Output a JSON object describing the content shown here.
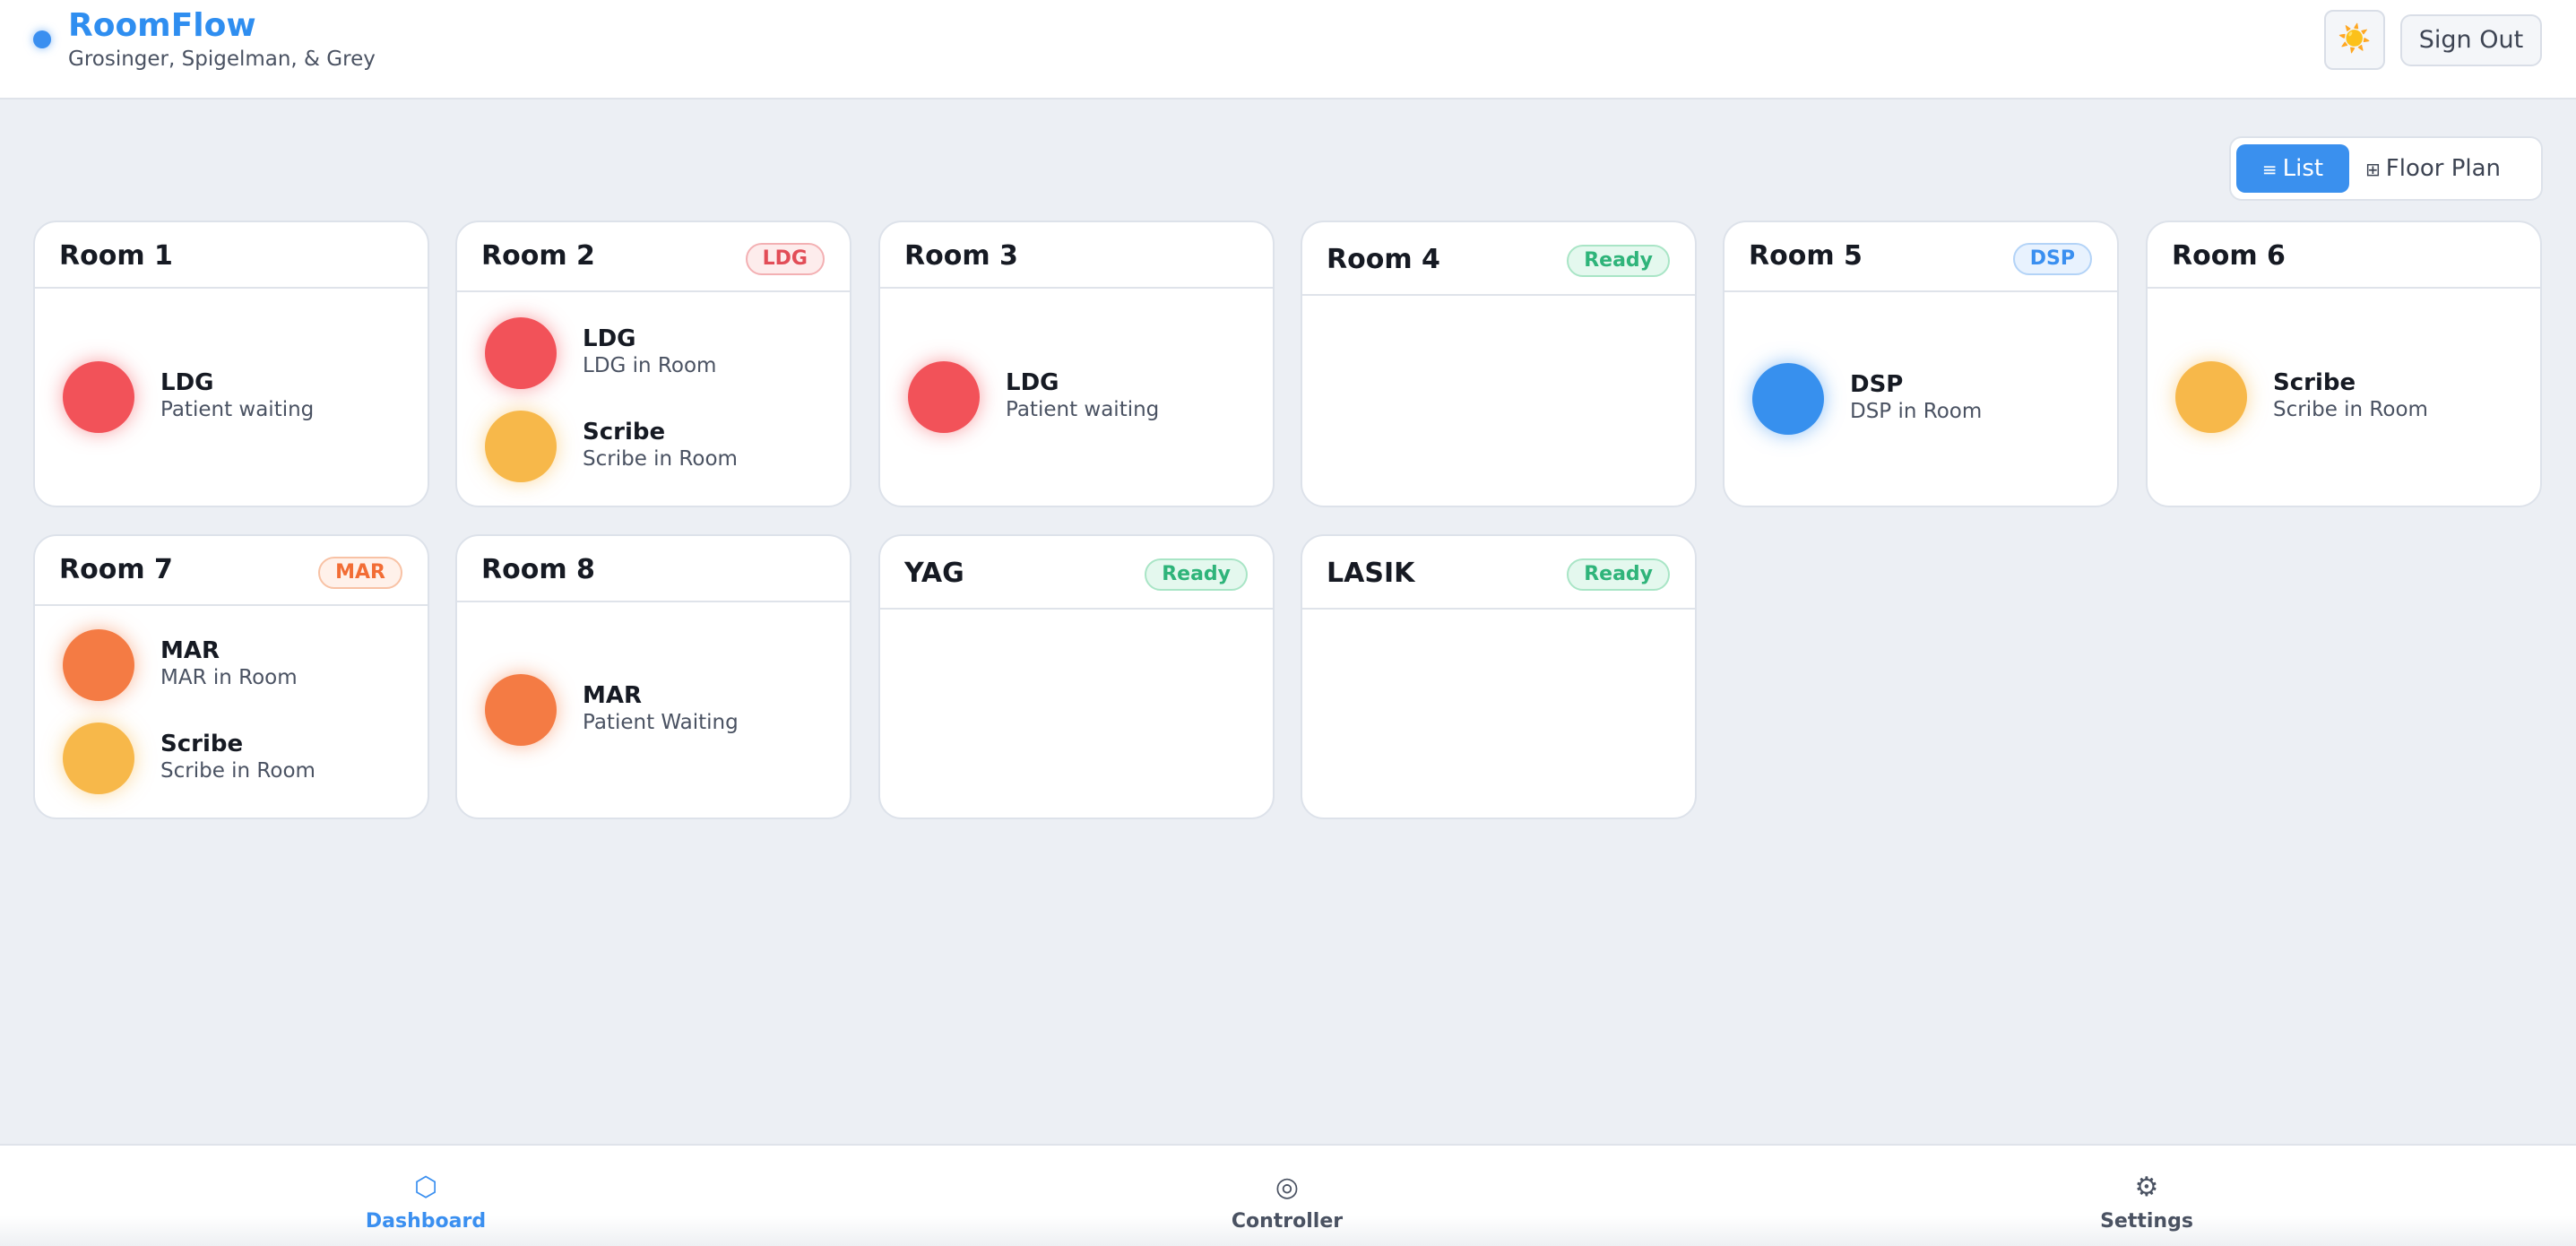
{
  "app": {
    "title": "RoomFlow",
    "subtitle": "Grosinger, Spigelman, & Grey",
    "theme_icon": "sun-icon",
    "theme_glyph": "☀️",
    "sign_out_label": "Sign Out"
  },
  "view_toggle": {
    "list_icon": "list-icon",
    "list_glyph": "≡",
    "list_label": "List",
    "floor_icon": "grid-icon",
    "floor_glyph": "⊞",
    "floor_label": "Floor Plan",
    "selected": "List"
  },
  "colors": {
    "accent": "#3a8ff0",
    "ldg": "#f25259",
    "scribe": "#f7b84a",
    "dsp": "#3790ee",
    "mar": "#f47b44",
    "ready": "#2fb47a"
  },
  "rooms": [
    {
      "name": "Room 1",
      "badge": "",
      "entries": [
        {
          "title": "LDG",
          "status": "Patient waiting"
        }
      ]
    },
    {
      "name": "Room 2",
      "badge": "LDG",
      "entries": [
        {
          "title": "LDG",
          "status": "LDG in Room"
        },
        {
          "title": "Scribe",
          "status": "Scribe in Room"
        }
      ]
    },
    {
      "name": "Room 3",
      "badge": "",
      "entries": [
        {
          "title": "LDG",
          "status": "Patient waiting"
        }
      ]
    },
    {
      "name": "Room 4",
      "badge": "Ready",
      "entries": []
    },
    {
      "name": "Room 5",
      "badge": "DSP",
      "entries": [
        {
          "title": "DSP",
          "status": "DSP in Room"
        }
      ]
    },
    {
      "name": "Room 6",
      "badge": "",
      "entries": [
        {
          "title": "Scribe",
          "status": "Scribe in Room"
        }
      ]
    },
    {
      "name": "Room 7",
      "badge": "MAR",
      "entries": [
        {
          "title": "MAR",
          "status": "MAR in Room"
        },
        {
          "title": "Scribe",
          "status": "Scribe in Room"
        }
      ]
    },
    {
      "name": "Room 8",
      "badge": "",
      "entries": [
        {
          "title": "MAR",
          "status": "Patient Waiting"
        }
      ]
    },
    {
      "name": "YAG",
      "badge": "Ready",
      "entries": []
    },
    {
      "name": "LASIK",
      "badge": "Ready",
      "entries": []
    }
  ],
  "nav": [
    {
      "label": "Dashboard",
      "icon": "hexagon-icon",
      "glyph": "⬡",
      "active": true
    },
    {
      "label": "Controller",
      "icon": "target-icon",
      "glyph": "◎",
      "active": false
    },
    {
      "label": "Settings",
      "icon": "gear-icon",
      "glyph": "⚙",
      "active": false
    }
  ]
}
